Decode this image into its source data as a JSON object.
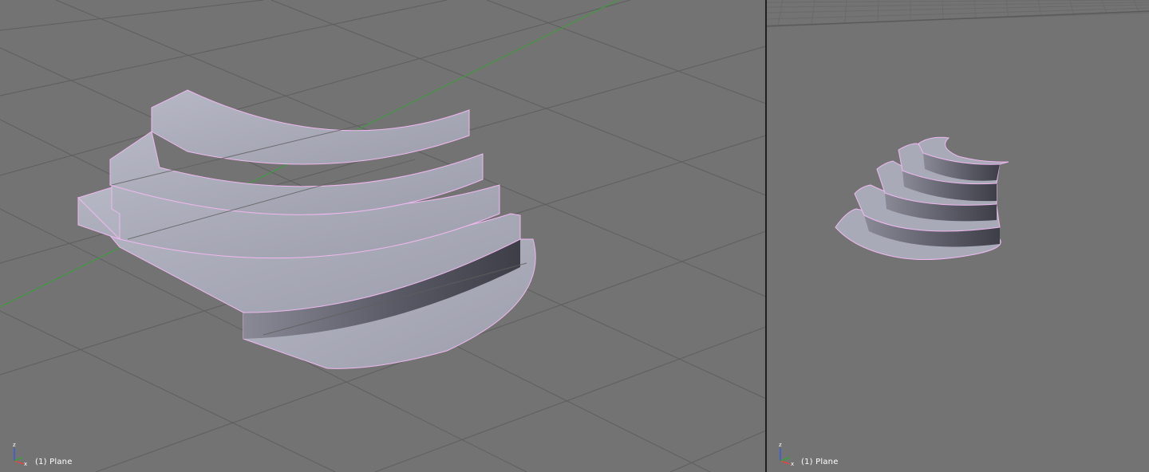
{
  "viewports": {
    "left": {
      "object_info": "(1) Plane"
    },
    "right": {
      "object_info": "(1) Plane"
    }
  },
  "colors": {
    "background": "#737373",
    "grid": "#5c5c5c",
    "x_axis": "#3aa13a",
    "selection_outline": "#f0b8f0",
    "mesh_top": "#a9aab8",
    "mesh_side": "#4e4e5a",
    "divider": "#1f1f1f"
  },
  "icons": {
    "axis_gizmo": "xyz-axis-icon"
  }
}
